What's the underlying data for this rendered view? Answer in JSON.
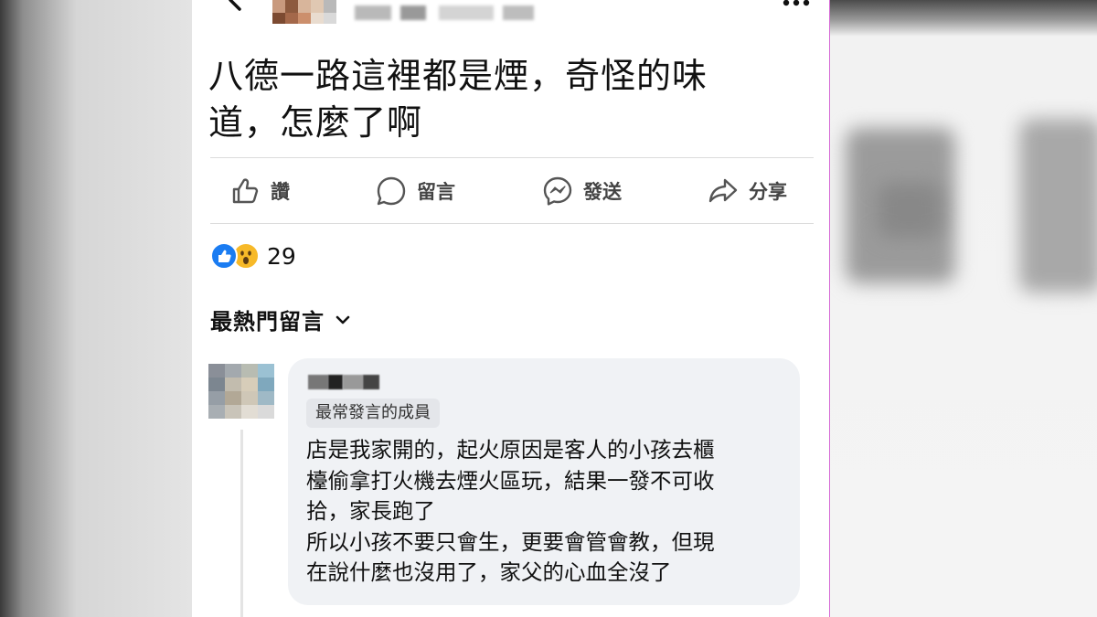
{
  "post": {
    "text_lines": [
      "八德一路這裡都是煙，奇怪的味",
      "道，怎麼了啊"
    ]
  },
  "actions": {
    "like": "讚",
    "comment": "留言",
    "send": "發送",
    "share": "分享"
  },
  "reactions": {
    "count": "29"
  },
  "comments_sort": {
    "label": "最熱門留言"
  },
  "comment": {
    "badge": "最常發言的成員",
    "text_lines": [
      "店是我家開的，起火原因是客人的小孩去櫃",
      "檯偷拿打火機去煙火區玩，結果一發不可收",
      "拾，家長跑了",
      "所以小孩不要只會生，更要會管會教，但現",
      "在說什麼也沒用了，家父的心血全沒了"
    ]
  },
  "colors": {
    "like_blue": "#1a7cf2",
    "wow_yellow": "#f7b928",
    "bubble_bg": "#f0f2f5",
    "text": "#111111"
  },
  "icons": [
    "back-icon",
    "more-icon",
    "like-icon",
    "comment-icon",
    "messenger-icon",
    "share-icon",
    "chevron-down-icon"
  ]
}
